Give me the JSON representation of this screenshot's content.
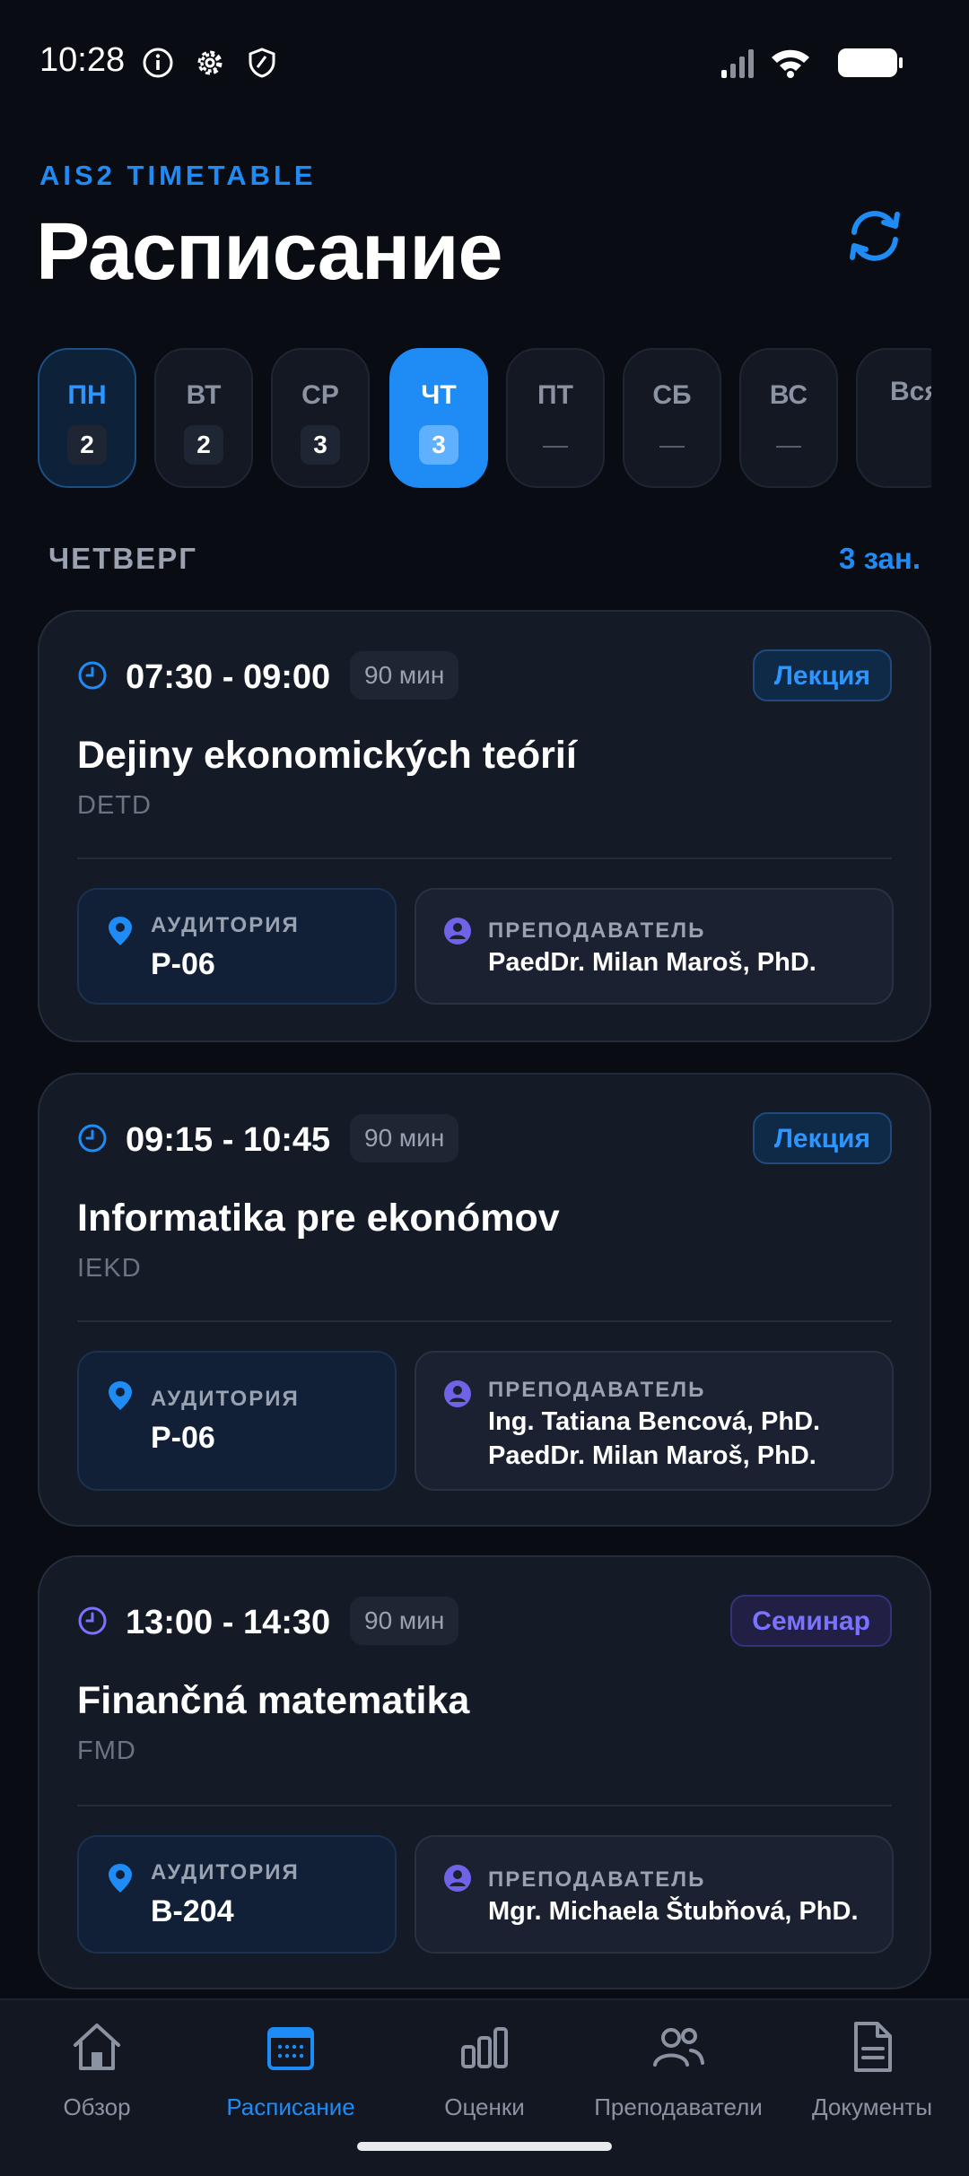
{
  "status_bar": {
    "time": "10:28"
  },
  "header": {
    "subtitle": "AIS2 TIMETABLE",
    "title": "Расписание"
  },
  "days": [
    {
      "label": "ПН",
      "count": "2"
    },
    {
      "label": "ВТ",
      "count": "2"
    },
    {
      "label": "СР",
      "count": "3"
    },
    {
      "label": "ЧТ",
      "count": "3"
    },
    {
      "label": "ПТ",
      "count": "—"
    },
    {
      "label": "СБ",
      "count": "—"
    },
    {
      "label": "ВС",
      "count": "—"
    },
    {
      "label": "Вся",
      "count": ""
    }
  ],
  "selected_day": "ЧТ",
  "section": {
    "label": "ЧЕТВЕРГ",
    "count": "3 зан."
  },
  "lessons": [
    {
      "time": "07:30 - 09:00",
      "duration": "90 мин",
      "type": "Лекция",
      "name": "Dejiny ekonomických teórií",
      "code": "DETD",
      "room_label": "АУДИТОРИЯ",
      "room": "P-06",
      "teacher_label": "ПРЕПОДАВАТЕЛЬ",
      "teachers": [
        "PaedDr. Milan Maroš, PhD."
      ]
    },
    {
      "time": "09:15 - 10:45",
      "duration": "90 мин",
      "type": "Лекция",
      "name": "Informatika pre ekonómov",
      "code": "IEKD",
      "room_label": "АУДИТОРИЯ",
      "room": "P-06",
      "teacher_label": "ПРЕПОДАВАТЕЛЬ",
      "teachers": [
        "Ing. Tatiana Bencová, PhD.",
        "PaedDr. Milan Maroš, PhD."
      ]
    },
    {
      "time": "13:00 - 14:30",
      "duration": "90 мин",
      "type": "Семинар",
      "name": "Finančná matematika",
      "code": "FMD",
      "room_label": "АУДИТОРИЯ",
      "room": "B-204",
      "teacher_label": "ПРЕПОДАВАТЕЛЬ",
      "teachers": [
        "Mgr. Michaela Štubňová, PhD."
      ]
    }
  ],
  "nav": [
    {
      "label": "Обзор",
      "icon": "home-icon"
    },
    {
      "label": "Расписание",
      "icon": "calendar-icon"
    },
    {
      "label": "Оценки",
      "icon": "bar-chart-icon"
    },
    {
      "label": "Преподаватели",
      "icon": "users-icon"
    },
    {
      "label": "Документы",
      "icon": "document-icon"
    }
  ],
  "colors": {
    "accent": "#1f8bf5",
    "seminar": "#7b72ff",
    "background": "#090c12",
    "card": "#141a26"
  }
}
